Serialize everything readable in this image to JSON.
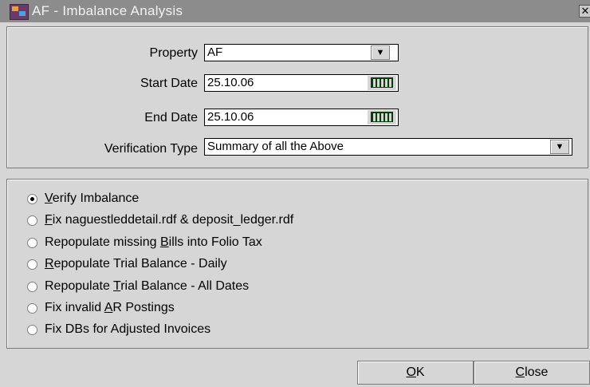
{
  "window": {
    "title": "AF - Imbalance Analysis",
    "close_glyph": "✕"
  },
  "form": {
    "property": {
      "label": "Property",
      "value": "AF"
    },
    "start_date": {
      "label": "Start Date",
      "value": "25.10.06"
    },
    "end_date": {
      "label": "End Date",
      "value": "25.10.06"
    },
    "verification_type": {
      "label": "Verification Type",
      "value": "Summary of all the Above"
    }
  },
  "options": [
    {
      "pre": "",
      "key": "V",
      "post": "erify Imbalance",
      "selected": true
    },
    {
      "pre": "",
      "key": "F",
      "post": "ix naguestleddetail.rdf  &  deposit_ledger.rdf",
      "selected": false
    },
    {
      "pre": "Repopulate missing ",
      "key": "B",
      "post": "ills into Folio Tax",
      "selected": false
    },
    {
      "pre": "",
      "key": "R",
      "post": "epopulate Trial Balance - Daily",
      "selected": false
    },
    {
      "pre": "Repopulate ",
      "key": "T",
      "post": "rial Balance - All Dates",
      "selected": false
    },
    {
      "pre": "Fix invalid ",
      "key": "A",
      "post": "R Postings",
      "selected": false
    },
    {
      "pre": "Fix DBs for Adjusted Invoices",
      "key": "",
      "post": "",
      "selected": false
    }
  ],
  "buttons": {
    "ok": {
      "key": "O",
      "rest": "K"
    },
    "close": {
      "key": "C",
      "rest": "lose"
    }
  },
  "icons": {
    "app": "app-icon",
    "dropdown": "chevron-down-icon",
    "calendar": "calendar-icon"
  }
}
